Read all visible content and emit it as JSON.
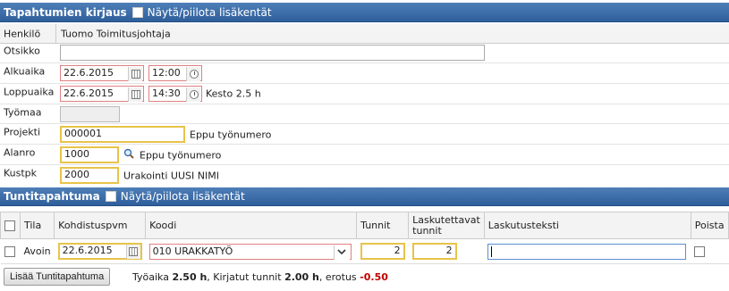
{
  "header": {
    "title": "Tapahtumien kirjaus",
    "toggle_label": "Näytä/piilota lisäkentät"
  },
  "form": {
    "henkilo_label": "Henkilö",
    "henkilo_value": "Tuomo Toimitusjohtaja",
    "otsikko_label": "Otsikko",
    "otsikko_value": "",
    "alkuaika_label": "Alkuaika",
    "alkuaika_date": "22.6.2015",
    "alkuaika_time": "12:00",
    "loppuaika_label": "Loppuaika",
    "loppuaika_date": "22.6.2015",
    "loppuaika_time": "14:30",
    "kesto_text": "Kesto 2.5 h",
    "tyomaa_label": "Työmaa",
    "tyomaa_value": "",
    "projekti_label": "Projekti",
    "projekti_value": "000001",
    "projekti_name": "Eppu työnumero",
    "alanro_label": "Alanro",
    "alanro_value": "1000",
    "alanro_name": "Eppu työnumero",
    "kustpk_label": "Kustpk",
    "kustpk_value": "2000",
    "kustpk_name": "Urakointi UUSI NIMI"
  },
  "section2": {
    "title": "Tuntitapahtuma",
    "toggle_label": "Näytä/piilota lisäkentät"
  },
  "table": {
    "headers": {
      "tila": "Tila",
      "kohdistuspvm": "Kohdistuspvm",
      "koodi": "Koodi",
      "tunnit": "Tunnit",
      "laskutettavat_1": "Laskutettavat",
      "laskutettavat_2": "tunnit",
      "laskutusteksti": "Laskutusteksti",
      "poista": "Poista"
    },
    "row": {
      "tila": "Avoin",
      "kohdistuspvm": "22.6.2015",
      "koodi": "010 URAKKATYÖ",
      "tunnit": "2",
      "laskutettavat": "2",
      "laskutusteksti": ""
    }
  },
  "footer": {
    "add_button": "Lisää Tuntitapahtuma",
    "tyoaika_label": "Työaika",
    "tyoaika_value": "2.50 h",
    "kirjatut_label": ", Kirjatut tunnit",
    "kirjatut_value": "2.00 h",
    "erotus_label": ", erotus",
    "erotus_value": "-0.50"
  },
  "colors": {
    "header_bar": "#3c6ca8",
    "negative": "#c00000",
    "required_border": "#e8c34a",
    "invalid_border": "#e08080"
  }
}
